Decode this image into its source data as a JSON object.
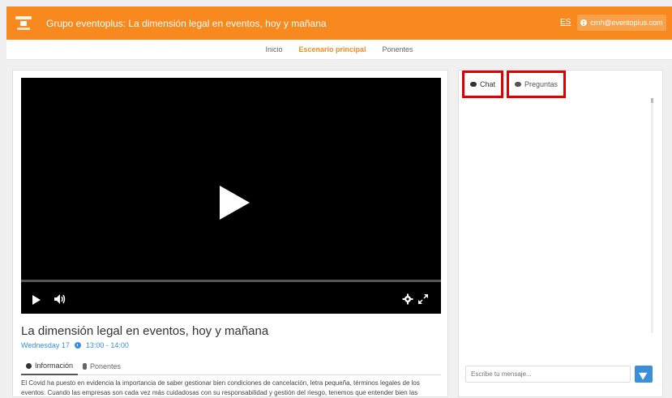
{
  "header": {
    "event_title": "Grupo eventoplus: La dimensión legal en eventos, hoy y mañana",
    "language": "ES",
    "user_email": "cmh@eventoplus.com"
  },
  "nav": {
    "items": [
      "Inicio",
      "Escenario principal",
      "Ponentes"
    ],
    "active": "Escenario principal"
  },
  "talk": {
    "title": "La dimensión legal en eventos, hoy y mañana",
    "day": "Wednesday 17",
    "time": "13:00 - 14:00",
    "tabs": [
      "Información",
      "Ponentes"
    ],
    "description": "El Covid ha puesto en evidencia la importancia de saber gestionar bien condiciones de cancelación, letra pequeña, términos legales de los eventos. Cuando las empresas son cada vez más cuidadosas con su responsabilidad y gestión del riesgo, tenemos que entender bien las"
  },
  "chat": {
    "tabs": [
      "Chat",
      "Preguntas"
    ],
    "input_placeholder": "Escribe tu mensaje..."
  },
  "colors": {
    "brand": "#f7891f",
    "accent": "#3a8fd8",
    "highlight": "#e00000"
  }
}
